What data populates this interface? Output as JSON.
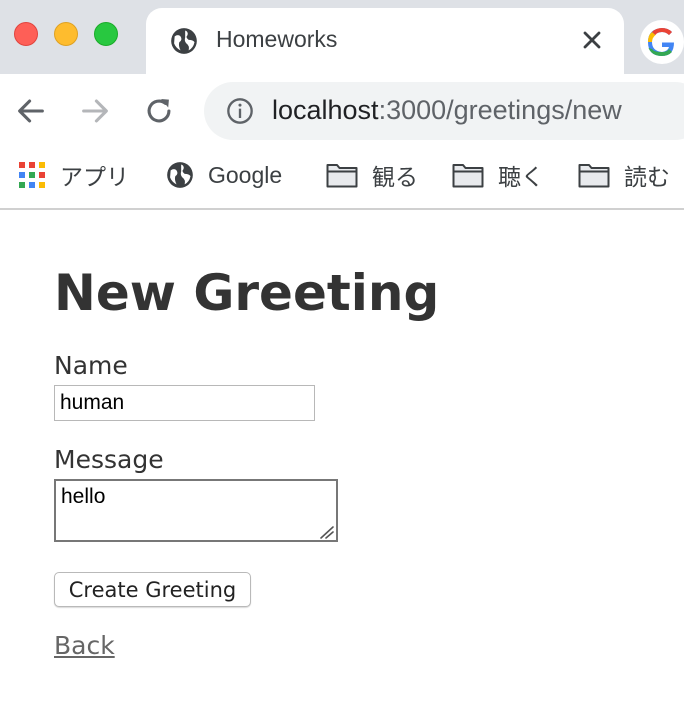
{
  "browser": {
    "tab": {
      "title": "Homeworks"
    },
    "address_bar": {
      "host": "localhost",
      "path": ":3000/greetings/new"
    },
    "bookmarks": [
      {
        "label": "アプリ",
        "icon": "apps-grid-icon"
      },
      {
        "label": "Google",
        "icon": "globe-icon"
      },
      {
        "label": "観る",
        "icon": "folder-icon"
      },
      {
        "label": "聴く",
        "icon": "folder-icon"
      },
      {
        "label": "読む",
        "icon": "folder-icon"
      }
    ],
    "colors": {
      "tabstrip": "#dee1e6",
      "omnibox": "#f1f3f4"
    }
  },
  "form": {
    "title": "New Greeting",
    "name_label": "Name",
    "name_value": "human",
    "message_label": "Message",
    "message_value": "hello",
    "submit_label": "Create Greeting",
    "back_label": "Back"
  }
}
